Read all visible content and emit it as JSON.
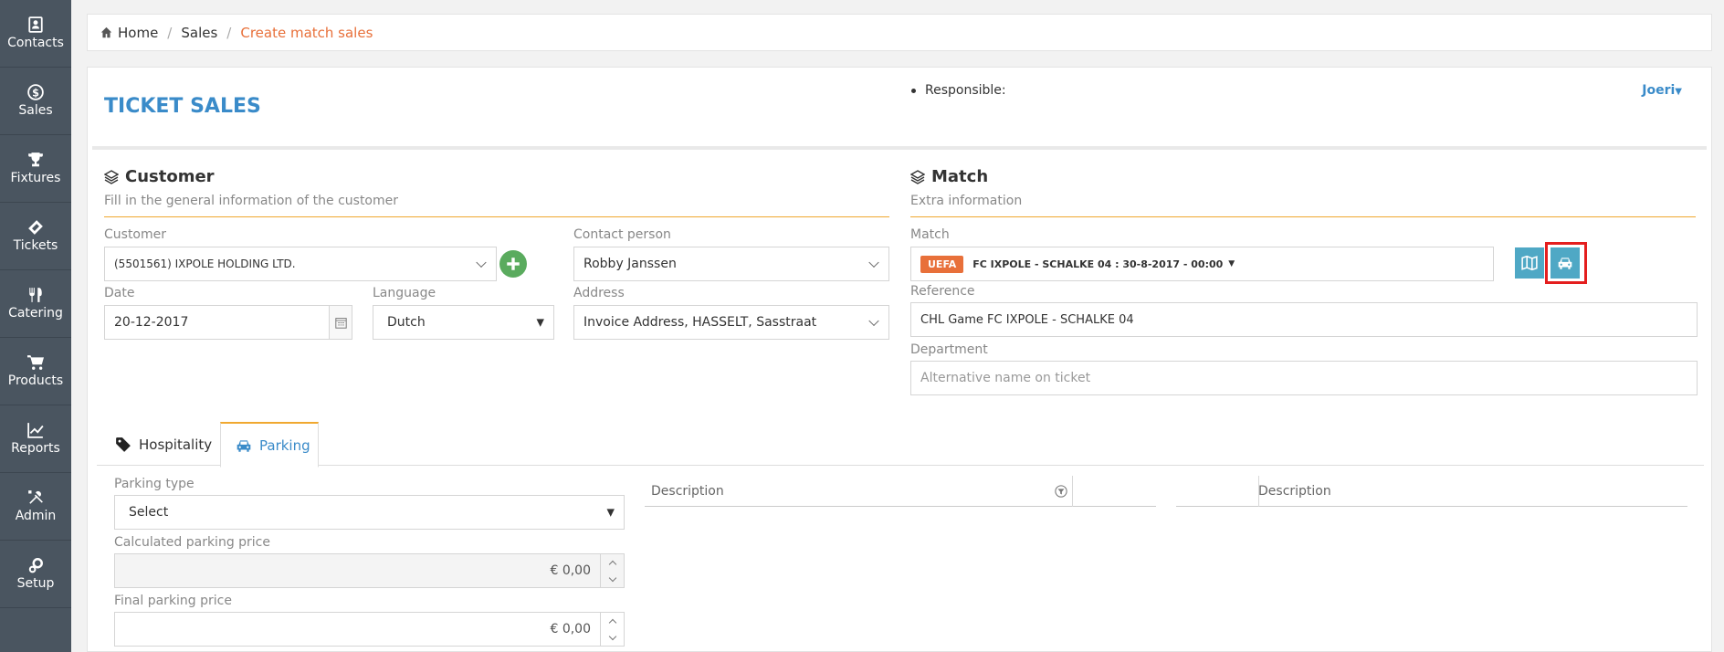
{
  "sidebar": {
    "items": [
      {
        "label": "Contacts",
        "icon": "contacts-icon"
      },
      {
        "label": "Sales",
        "icon": "dollar-icon"
      },
      {
        "label": "Fixtures",
        "icon": "trophy-icon"
      },
      {
        "label": "Tickets",
        "icon": "ticket-icon"
      },
      {
        "label": "Catering",
        "icon": "cutlery-icon"
      },
      {
        "label": "Products",
        "icon": "cart-icon"
      },
      {
        "label": "Reports",
        "icon": "chart-icon"
      },
      {
        "label": "Admin",
        "icon": "tools-icon"
      },
      {
        "label": "Setup",
        "icon": "cogs-icon"
      }
    ]
  },
  "breadcrumb": {
    "home": "Home",
    "sales": "Sales",
    "current": "Create match sales"
  },
  "header": {
    "title": "TICKET SALES",
    "responsible_label": "Responsible:",
    "user": "Joeri"
  },
  "customer_section": {
    "title": "Customer",
    "subtitle": "Fill in the general information of the customer",
    "customer_label": "Customer",
    "customer_value": "(5501561) IXPOLE HOLDING LTD.",
    "contact_label": "Contact person",
    "contact_value": "Robby Janssen",
    "date_label": "Date",
    "date_value": "20-12-2017",
    "language_label": "Language",
    "language_value": "Dutch",
    "address_label": "Address",
    "address_value": "Invoice Address, HASSELT, Sasstraat"
  },
  "match_section": {
    "title": "Match",
    "subtitle": "Extra information",
    "match_label": "Match",
    "match_badge": "UEFA",
    "match_value": "FC IXPOLE - SCHALKE 04 : 30-8-2017 - 00:00",
    "reference_label": "Reference",
    "reference_value": "CHL Game FC IXPOLE - SCHALKE 04",
    "department_label": "Department",
    "department_placeholder": "Alternative name on ticket"
  },
  "tabs": [
    {
      "label": "Hospitality",
      "icon": "tag-icon",
      "active": false
    },
    {
      "label": "Parking",
      "icon": "car-icon",
      "active": true
    }
  ],
  "parking": {
    "type_label": "Parking type",
    "type_value": "Select",
    "calc_label": "Calculated parking price",
    "calc_value": "€ 0,00",
    "final_label": "Final parking price",
    "final_value": "€ 0,00"
  },
  "grid_left": {
    "header": "Description"
  },
  "grid_right": {
    "header": "Description"
  },
  "colors": {
    "accent": "#3a8bc9",
    "orange": "#e8703a",
    "teal": "#4fa8c5",
    "sidebar": "#4a5560",
    "highlight": "#e41e1e"
  }
}
